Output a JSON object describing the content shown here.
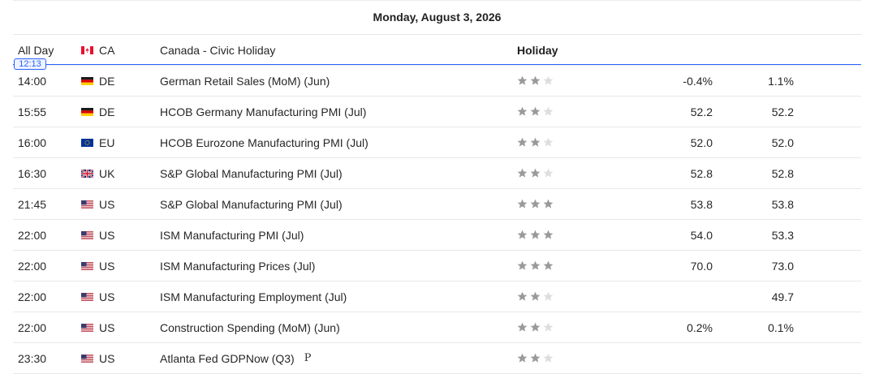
{
  "calendar": {
    "date": "Monday, August 3, 2026",
    "now_time": "12:13",
    "star_color_on": "#9a9a9a",
    "star_color_off": "#dedede",
    "now_color": "#2962ff",
    "events": [
      {
        "time": "All Day",
        "country": "CA",
        "event": "Canada - Civic Holiday",
        "holiday": "Holiday",
        "importance": 0,
        "actual": "",
        "forecast": ""
      },
      {
        "time": "14:00",
        "country": "DE",
        "event": "German Retail Sales (MoM) (Jun)",
        "importance": 2,
        "actual": "-0.4%",
        "forecast": "1.1%"
      },
      {
        "time": "15:55",
        "country": "DE",
        "event": "HCOB Germany Manufacturing PMI (Jul)",
        "importance": 2,
        "actual": "52.2",
        "forecast": "52.2"
      },
      {
        "time": "16:00",
        "country": "EU",
        "event": "HCOB Eurozone Manufacturing PMI (Jul)",
        "importance": 2,
        "actual": "52.0",
        "forecast": "52.0"
      },
      {
        "time": "16:30",
        "country": "UK",
        "event": "S&P Global Manufacturing PMI (Jul)",
        "importance": 2,
        "actual": "52.8",
        "forecast": "52.8"
      },
      {
        "time": "21:45",
        "country": "US",
        "event": "S&P Global Manufacturing PMI (Jul)",
        "importance": 3,
        "actual": "53.8",
        "forecast": "53.8"
      },
      {
        "time": "22:00",
        "country": "US",
        "event": "ISM Manufacturing PMI (Jul)",
        "importance": 3,
        "actual": "54.0",
        "forecast": "53.3"
      },
      {
        "time": "22:00",
        "country": "US",
        "event": "ISM Manufacturing Prices (Jul)",
        "importance": 3,
        "actual": "70.0",
        "forecast": "73.0"
      },
      {
        "time": "22:00",
        "country": "US",
        "event": "ISM Manufacturing Employment (Jul)",
        "importance": 2,
        "actual": "",
        "forecast": "49.7"
      },
      {
        "time": "22:00",
        "country": "US",
        "event": "Construction Spending (MoM) (Jun)",
        "importance": 2,
        "actual": "0.2%",
        "forecast": "0.1%"
      },
      {
        "time": "23:30",
        "country": "US",
        "event": "Atlanta Fed GDPNow (Q3)",
        "suffix": "P",
        "importance": 2,
        "actual": "",
        "forecast": ""
      }
    ]
  }
}
